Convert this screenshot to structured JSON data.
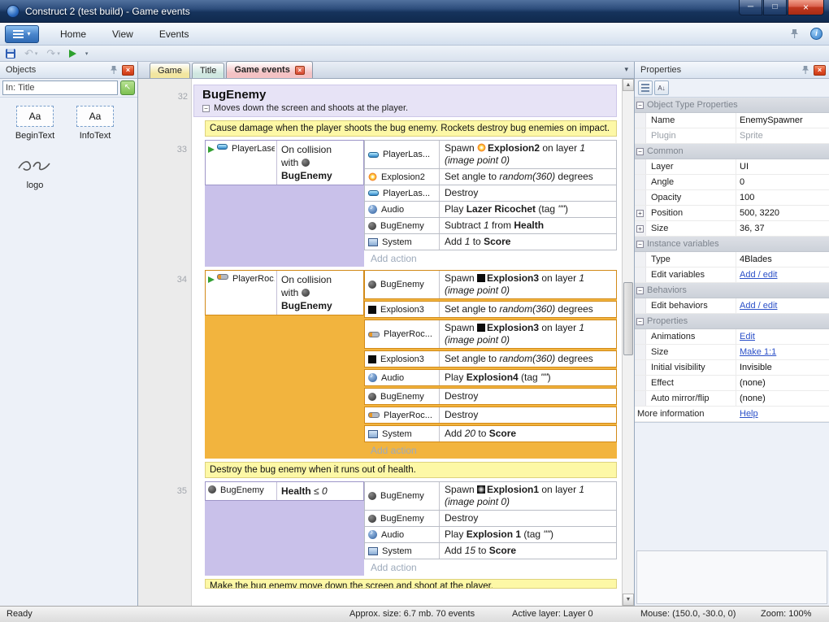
{
  "window": {
    "title": "Construct 2 (test build) - Game events"
  },
  "colors": {
    "selection": "#f2b43e",
    "event_margin": "#c9c1ea",
    "comment_bg": "#fdf8a6",
    "group_bg": "#e7e3f6",
    "link": "#2b50c8"
  },
  "menubar": {
    "tabs": [
      "Home",
      "View",
      "Events"
    ]
  },
  "toolbar": {
    "buttons": [
      {
        "name": "save",
        "enabled": true
      },
      {
        "name": "undo",
        "enabled": false
      },
      {
        "name": "redo",
        "enabled": false
      },
      {
        "name": "run",
        "enabled": true
      },
      {
        "name": "customize",
        "enabled": true
      }
    ]
  },
  "objects_panel": {
    "title": "Objects",
    "filter": "In: Title",
    "items": [
      {
        "label": "BeginText",
        "icon": "text-object",
        "icon_text": "Aa"
      },
      {
        "label": "InfoText",
        "icon": "text-object",
        "icon_text": "Aa"
      },
      {
        "label": "logo",
        "icon": "logo-sprite"
      }
    ]
  },
  "doc_tabs": [
    {
      "label": "Game",
      "color": "#f2e6a0",
      "active": false,
      "closable": false
    },
    {
      "label": "Title",
      "color": "#cfe7e0",
      "active": false,
      "closable": false
    },
    {
      "label": "Game events",
      "color": "#f4c2c4",
      "active": true,
      "closable": true
    }
  ],
  "event_sheet": {
    "group": {
      "number": "32",
      "title": "BugEnemy",
      "description": "Moves down the screen and shoots at the player."
    },
    "blocks": [
      {
        "type": "comment",
        "text": "Cause damage when the player shoots the bug enemy.  Rockets destroy bug enemies on impact."
      },
      {
        "type": "event",
        "number": "33",
        "selected": false,
        "condition": {
          "arrow": true,
          "obj_icon": "laser",
          "obj_label": "PlayerLaser",
          "rich": [
            {
              "t": "On collision"
            },
            {
              "br": true
            },
            {
              "t": "with "
            },
            {
              "icon": "bug"
            },
            {
              "br": true
            },
            {
              "t": "BugEnemy",
              "b": true
            }
          ]
        },
        "actions": [
          {
            "obj_icon": "laser",
            "obj_label": "PlayerLas...",
            "rich": [
              {
                "t": "Spawn "
              },
              {
                "icon": "explosion2"
              },
              {
                "t": "Explosion2",
                "b": true
              },
              {
                "t": " on layer "
              },
              {
                "t": "1",
                "i": true
              },
              {
                "br": true
              },
              {
                "t": "(image point 0)",
                "i": true
              }
            ]
          },
          {
            "obj_icon": "explosion2",
            "obj_label": "Explosion2",
            "rich": [
              {
                "t": "Set angle to "
              },
              {
                "t": "random(360)",
                "i": true
              },
              {
                "t": " degrees"
              }
            ]
          },
          {
            "obj_icon": "laser",
            "obj_label": "PlayerLas...",
            "rich": [
              {
                "t": "Destroy"
              }
            ]
          },
          {
            "obj_icon": "audio",
            "obj_label": "Audio",
            "rich": [
              {
                "t": "Play "
              },
              {
                "t": "Lazer Ricochet",
                "b": true
              },
              {
                "t": " (tag "
              },
              {
                "t": "\"\"",
                "i": true
              },
              {
                "t": ")"
              }
            ]
          },
          {
            "obj_icon": "bug",
            "obj_label": "BugEnemy",
            "rich": [
              {
                "t": "Subtract "
              },
              {
                "t": "1",
                "i": true
              },
              {
                "t": " from "
              },
              {
                "t": "Health",
                "b": true
              }
            ]
          },
          {
            "obj_icon": "system",
            "obj_label": "System",
            "rich": [
              {
                "t": "Add "
              },
              {
                "t": "1",
                "i": true
              },
              {
                "t": " to "
              },
              {
                "t": "Score",
                "b": true
              }
            ]
          }
        ],
        "add_action": "Add action"
      },
      {
        "type": "event",
        "number": "34",
        "selected": true,
        "condition": {
          "arrow": true,
          "obj_icon": "rocket",
          "obj_label": "PlayerRoc...",
          "rich": [
            {
              "t": "On collision"
            },
            {
              "br": true
            },
            {
              "t": "with "
            },
            {
              "icon": "bug"
            },
            {
              "br": true
            },
            {
              "t": "BugEnemy",
              "b": true
            }
          ]
        },
        "actions": [
          {
            "obj_icon": "bug",
            "obj_label": "BugEnemy",
            "rich": [
              {
                "t": "Spawn "
              },
              {
                "icon": "explosion3"
              },
              {
                "t": "Explosion3",
                "b": true
              },
              {
                "t": " on layer "
              },
              {
                "t": "1",
                "i": true
              },
              {
                "br": true
              },
              {
                "t": "(image point 0)",
                "i": true
              }
            ]
          },
          {
            "obj_icon": "explosion3",
            "obj_label": "Explosion3",
            "rich": [
              {
                "t": "Set angle to "
              },
              {
                "t": "random(360)",
                "i": true
              },
              {
                "t": " degrees"
              }
            ]
          },
          {
            "obj_icon": "rocket",
            "obj_label": "PlayerRoc...",
            "rich": [
              {
                "t": "Spawn "
              },
              {
                "icon": "explosion3"
              },
              {
                "t": "Explosion3",
                "b": true
              },
              {
                "t": " on layer "
              },
              {
                "t": "1",
                "i": true
              },
              {
                "br": true
              },
              {
                "t": "(image point 0)",
                "i": true
              }
            ]
          },
          {
            "obj_icon": "explosion3",
            "obj_label": "Explosion3",
            "rich": [
              {
                "t": "Set angle to "
              },
              {
                "t": "random(360)",
                "i": true
              },
              {
                "t": " degrees"
              }
            ]
          },
          {
            "obj_icon": "audio",
            "obj_label": "Audio",
            "rich": [
              {
                "t": "Play "
              },
              {
                "t": "Explosion4",
                "b": true
              },
              {
                "t": " (tag "
              },
              {
                "t": "\"\"",
                "i": true
              },
              {
                "t": ")"
              }
            ]
          },
          {
            "obj_icon": "bug",
            "obj_label": "BugEnemy",
            "rich": [
              {
                "t": "Destroy"
              }
            ]
          },
          {
            "obj_icon": "rocket",
            "obj_label": "PlayerRoc...",
            "rich": [
              {
                "t": "Destroy"
              }
            ]
          },
          {
            "obj_icon": "system",
            "obj_label": "System",
            "rich": [
              {
                "t": "Add "
              },
              {
                "t": "20",
                "i": true
              },
              {
                "t": " to "
              },
              {
                "t": "Score",
                "b": true
              }
            ]
          }
        ],
        "add_action": "Add action"
      },
      {
        "type": "comment",
        "text": "Destroy the bug enemy when it runs out of health."
      },
      {
        "type": "event",
        "number": "35",
        "selected": false,
        "condition": {
          "arrow": false,
          "obj_icon": "bug",
          "obj_label": "BugEnemy",
          "rich": [
            {
              "t": "Health",
              "b": true
            },
            {
              "t": " ≤ "
            },
            {
              "t": "0",
              "i": true
            }
          ]
        },
        "actions": [
          {
            "obj_icon": "bug",
            "obj_label": "BugEnemy",
            "rich": [
              {
                "t": "Spawn "
              },
              {
                "icon": "explosion1"
              },
              {
                "t": "Explosion1",
                "b": true
              },
              {
                "t": " on layer "
              },
              {
                "t": "1",
                "i": true
              },
              {
                "br": true
              },
              {
                "t": "(image point 0)",
                "i": true
              }
            ]
          },
          {
            "obj_icon": "bug",
            "obj_label": "BugEnemy",
            "rich": [
              {
                "t": "Destroy"
              }
            ]
          },
          {
            "obj_icon": "audio",
            "obj_label": "Audio",
            "rich": [
              {
                "t": "Play "
              },
              {
                "t": "Explosion 1",
                "b": true
              },
              {
                "t": " (tag "
              },
              {
                "t": "\"\"",
                "i": true
              },
              {
                "t": ")"
              }
            ]
          },
          {
            "obj_icon": "system",
            "obj_label": "System",
            "rich": [
              {
                "t": "Add "
              },
              {
                "t": "15",
                "i": true
              },
              {
                "t": " to "
              },
              {
                "t": "Score",
                "b": true
              }
            ]
          }
        ],
        "add_action": "Add action"
      },
      {
        "type": "comment",
        "text": "Make the bug enemy move down the screen and shoot at the player.",
        "clipped": true
      }
    ]
  },
  "properties_panel": {
    "title": "Properties",
    "sections": [
      {
        "header": "Object Type Properties",
        "rows": [
          {
            "label": "Name",
            "value": "EnemySpawner"
          },
          {
            "label": "Plugin",
            "value": "Sprite",
            "muted": true
          }
        ]
      },
      {
        "header": "Common",
        "rows": [
          {
            "label": "Layer",
            "value": "UI"
          },
          {
            "label": "Angle",
            "value": "0"
          },
          {
            "label": "Opacity",
            "value": "100"
          },
          {
            "label": "Position",
            "value": "500, 3220",
            "expand": true
          },
          {
            "label": "Size",
            "value": "36, 37",
            "expand": true
          }
        ]
      },
      {
        "header": "Instance variables",
        "rows": [
          {
            "label": "Type",
            "value": "4Blades"
          },
          {
            "label": "Edit variables",
            "value": "Add / edit",
            "link": true
          }
        ]
      },
      {
        "header": "Behaviors",
        "rows": [
          {
            "label": "Edit behaviors",
            "value": "Add / edit",
            "link": true
          }
        ]
      },
      {
        "header": "Properties",
        "rows": [
          {
            "label": "Animations",
            "value": "Edit",
            "link": true
          },
          {
            "label": "Size",
            "value": "Make 1:1",
            "link": true
          },
          {
            "label": "Initial visibility",
            "value": "Invisible"
          },
          {
            "label": "Effect",
            "value": "(none)"
          },
          {
            "label": "Auto mirror/flip",
            "value": "(none)"
          }
        ]
      }
    ],
    "more_info": {
      "label": "More information",
      "value": "Help"
    }
  },
  "status_bar": {
    "ready": "Ready",
    "size": "Approx. size: 6.7 mb. 70 events",
    "layer": "Active layer: Layer 0",
    "mouse": "Mouse: (150.0, -30.0, 0)",
    "zoom": "Zoom: 100%"
  }
}
